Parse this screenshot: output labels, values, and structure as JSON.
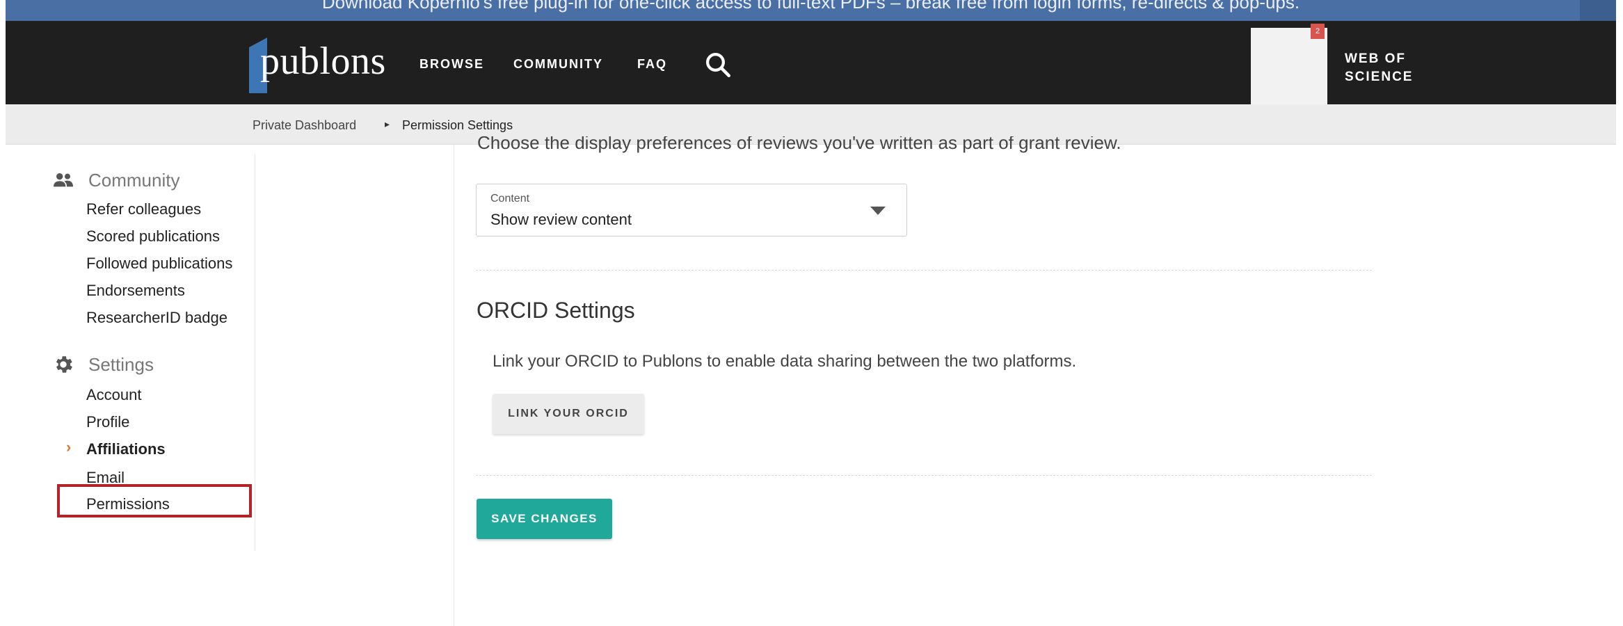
{
  "promo": {
    "text": "Download Kopernio's free plug-in for one-click access to full-text PDFs – break free from login forms, re-directs & pop-ups."
  },
  "nav": {
    "logo": "publons",
    "links": [
      "BROWSE",
      "COMMUNITY",
      "FAQ"
    ],
    "search_icon": "search-icon",
    "notification_count": "2",
    "web_of_science": "WEB OF SCIENCE"
  },
  "breadcrumb": {
    "home": "Private Dashboard",
    "separator_icon": "caret-right-icon",
    "current": "Permission Settings"
  },
  "sidebar": {
    "community": {
      "icon": "people-icon",
      "title": "Community",
      "items": [
        "Refer colleagues",
        "Scored publications",
        "Followed publications",
        "Endorsements",
        "ResearcherID badge"
      ]
    },
    "settings": {
      "icon": "gear-icon",
      "title": "Settings",
      "items": [
        "Account",
        "Profile",
        "Affiliations",
        "Email",
        "Permissions"
      ],
      "active": "Affiliations",
      "highlighted": "Permissions"
    }
  },
  "main": {
    "grant_description": "Choose the display preferences of reviews you've written as part of grant review.",
    "content_select": {
      "label": "Content",
      "value": "Show review content"
    },
    "orcid": {
      "title": "ORCID Settings",
      "description": "Link your ORCID to Publons to enable data sharing between the two platforms.",
      "button": "LINK YOUR ORCID"
    },
    "save_button": "SAVE CHANGES"
  },
  "colors": {
    "banner": "#4a6fa5",
    "nav_bg": "#1f1f1f",
    "logo_accent": "#3d75b5",
    "save_button": "#20a99a",
    "active_chevron": "#e07a2b",
    "highlight_box": "#b3232a"
  }
}
